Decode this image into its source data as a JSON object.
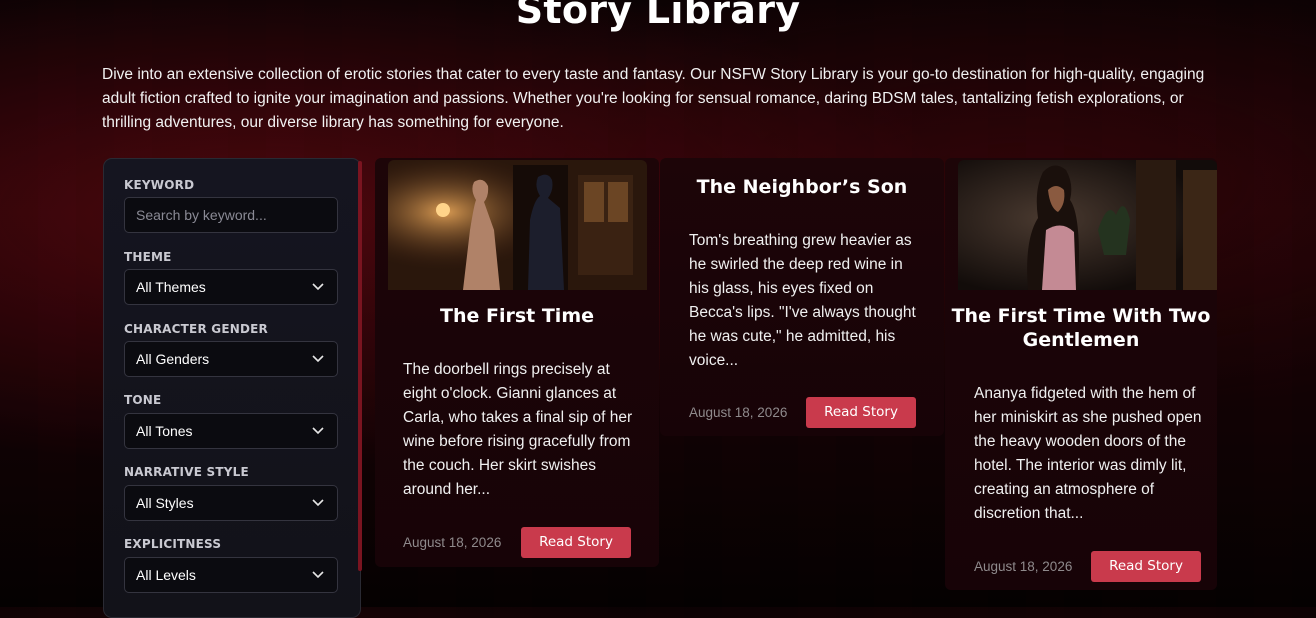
{
  "page": {
    "title": "Story Library",
    "intro": "Dive into an extensive collection of erotic stories that cater to every taste and fantasy. Our NSFW Story Library is your go-to destination for high-quality, engaging adult fiction crafted to ignite your imagination and passions. Whether you're looking for sensual romance, daring BDSM tales, tantalizing fetish explorations, or thrilling adventures, our diverse library has something for everyone."
  },
  "filters": {
    "keyword_label": "KEYWORD",
    "keyword_placeholder": "Search by keyword...",
    "theme_label": "THEME",
    "theme_value": "All Themes",
    "gender_label": "CHARACTER GENDER",
    "gender_value": "All Genders",
    "tone_label": "TONE",
    "tone_value": "All Tones",
    "style_label": "NARRATIVE STYLE",
    "style_value": "All Styles",
    "explicitness_label": "EXPLICITNESS",
    "explicitness_value": "All Levels",
    "dropdown_icon": "chevron-down-icon"
  },
  "stories": [
    {
      "title": "The First Time",
      "excerpt": "The doorbell rings precisely at eight o'clock. Gianni glances at Carla, who takes a final sip of her wine before rising gracefully from the couch. Her skirt swishes around her...",
      "date": "August 18, 2026",
      "button": "Read Story"
    },
    {
      "title": "The Neighbor’s Son",
      "excerpt": "Tom's breathing grew heavier as he swirled the deep red wine in his glass, his eyes fixed on Becca's lips. \"I've always thought he was cute,\" he admitted, his voice...",
      "date": "August 18, 2026",
      "button": "Read Story"
    },
    {
      "title": "The First Time With Two Gentlemen",
      "excerpt": "Ananya fidgeted with the hem of her miniskirt as she pushed open the heavy wooden doors of the hotel. The interior was dimly lit, creating an atmosphere of discretion that...",
      "date": "August 18, 2026",
      "button": "Read Story"
    }
  ],
  "colors": {
    "accent": "#c93a4c",
    "card_bg": "#1a0407",
    "sidebar_bg": "#14141d"
  }
}
